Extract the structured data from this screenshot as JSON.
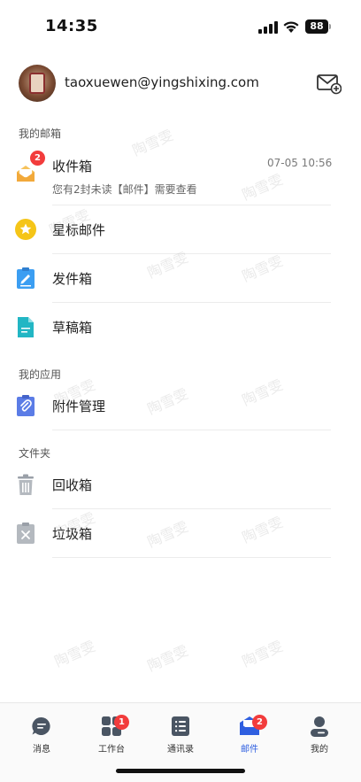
{
  "status_bar": {
    "time": "14:35",
    "battery": "88",
    "icons": [
      "signal-icon",
      "wifi-icon",
      "battery-icon"
    ]
  },
  "account": {
    "email": "taoxuewen@yingshixing.com",
    "compose_icon": "mail-plus-icon"
  },
  "sections": {
    "my_mailbox": "我的邮箱",
    "my_apps": "我的应用",
    "folders": "文件夹"
  },
  "mailbox": {
    "inbox": {
      "label": "收件箱",
      "badge": "2",
      "time": "07-05 10:56",
      "preview": "您有2封未读【邮件】需要查看",
      "icon": "envelope-open-icon"
    },
    "starred": {
      "label": "星标邮件",
      "icon": "star-icon"
    },
    "sent": {
      "label": "发件箱",
      "icon": "pen-icon"
    },
    "drafts": {
      "label": "草稿箱",
      "icon": "document-icon"
    }
  },
  "apps": {
    "attachments": {
      "label": "附件管理",
      "icon": "paperclip-icon"
    }
  },
  "folders": {
    "recycle": {
      "label": "回收箱",
      "icon": "trash-icon"
    },
    "spam": {
      "label": "垃圾箱",
      "icon": "spam-icon"
    }
  },
  "watermark": "陶雪雯",
  "tab_bar": {
    "tabs": [
      {
        "label": "消息",
        "icon": "chat-bubble-icon",
        "badge": ""
      },
      {
        "label": "工作台",
        "icon": "grid-icon",
        "badge": "1"
      },
      {
        "label": "通讯录",
        "icon": "contacts-icon",
        "badge": ""
      },
      {
        "label": "邮件",
        "icon": "mail-icon",
        "badge": "2"
      },
      {
        "label": "我的",
        "icon": "person-icon",
        "badge": ""
      }
    ],
    "active_index": 3
  },
  "colors": {
    "accent": "#2f5fe0",
    "badge": "#f23c3c",
    "star": "#f5c518",
    "sent": "#3b9ef2",
    "drafts": "#22b6c4",
    "attachments": "#5b7ce6",
    "trash": "#9aa0a8"
  }
}
